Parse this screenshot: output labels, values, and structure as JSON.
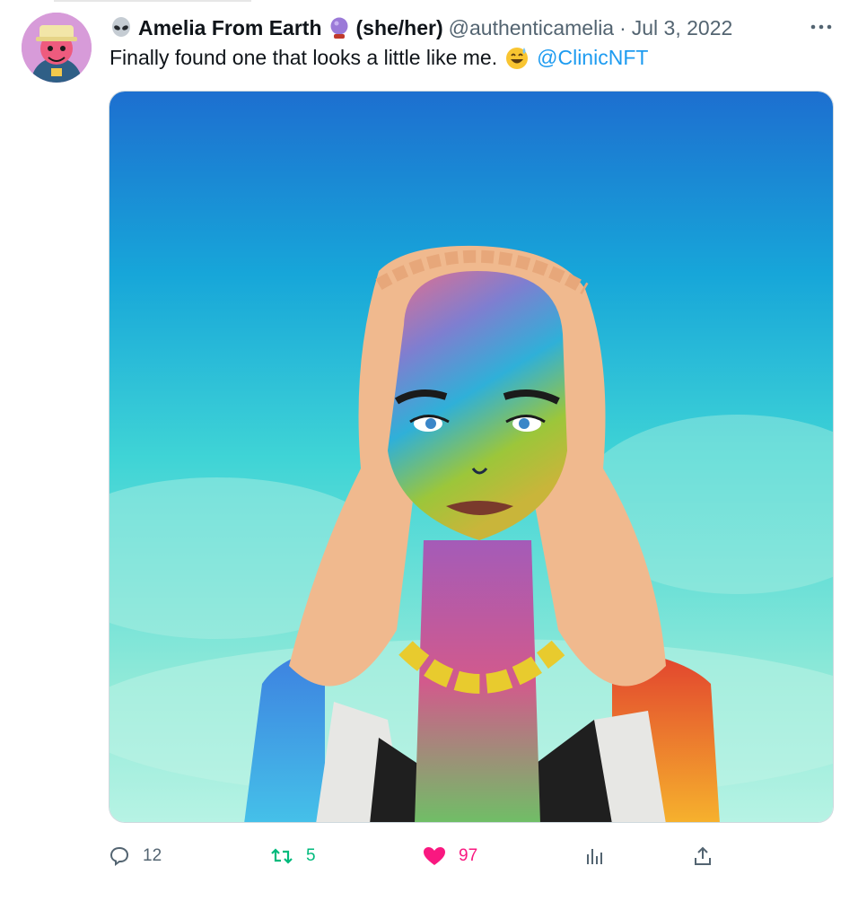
{
  "tweet": {
    "author_name": "Amelia From Earth",
    "pronouns": "(she/her)",
    "handle": "@authenticamelia",
    "separator": "·",
    "date": "Jul 3, 2022",
    "text": "Finally found one that looks a little like me.",
    "mention": "@ClinicNFT",
    "icons": {
      "name_prefix": "alien-emoji",
      "name_suffix": "crystal-ball-emoji",
      "text_emoji": "sweat-smile-emoji",
      "more": "more-dots-icon"
    }
  },
  "actions": {
    "reply_count": "12",
    "retweet_count": "5",
    "like_count": "97"
  },
  "colors": {
    "retweet": "#00ba7c",
    "like": "#f91880",
    "mention": "#1d9bf0",
    "muted": "#536471"
  }
}
